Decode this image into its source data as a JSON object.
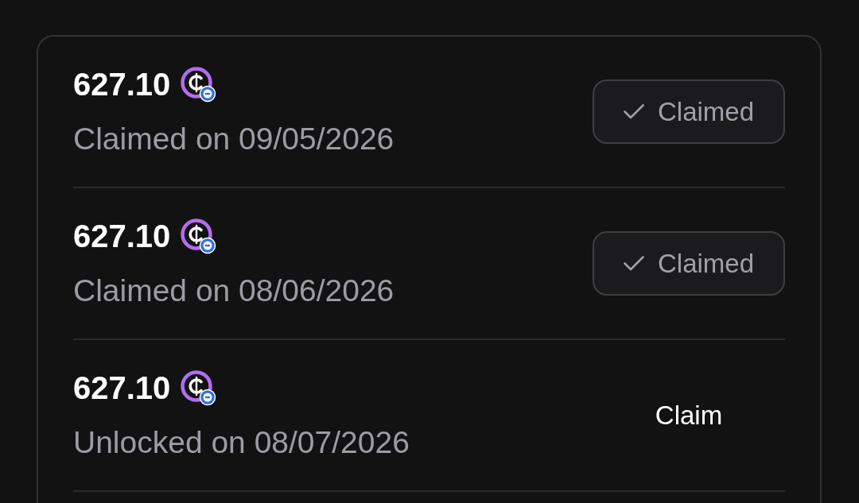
{
  "rewards": [
    {
      "amount": "627.10",
      "status": "Claimed on 09/05/2026",
      "action": {
        "kind": "claimed",
        "label": "Claimed"
      }
    },
    {
      "amount": "627.10",
      "status": "Claimed on 08/06/2026",
      "action": {
        "kind": "claimed",
        "label": "Claimed"
      }
    },
    {
      "amount": "627.10",
      "status": "Unlocked on 08/07/2026",
      "action": {
        "kind": "claim",
        "label": "Claim"
      }
    }
  ]
}
